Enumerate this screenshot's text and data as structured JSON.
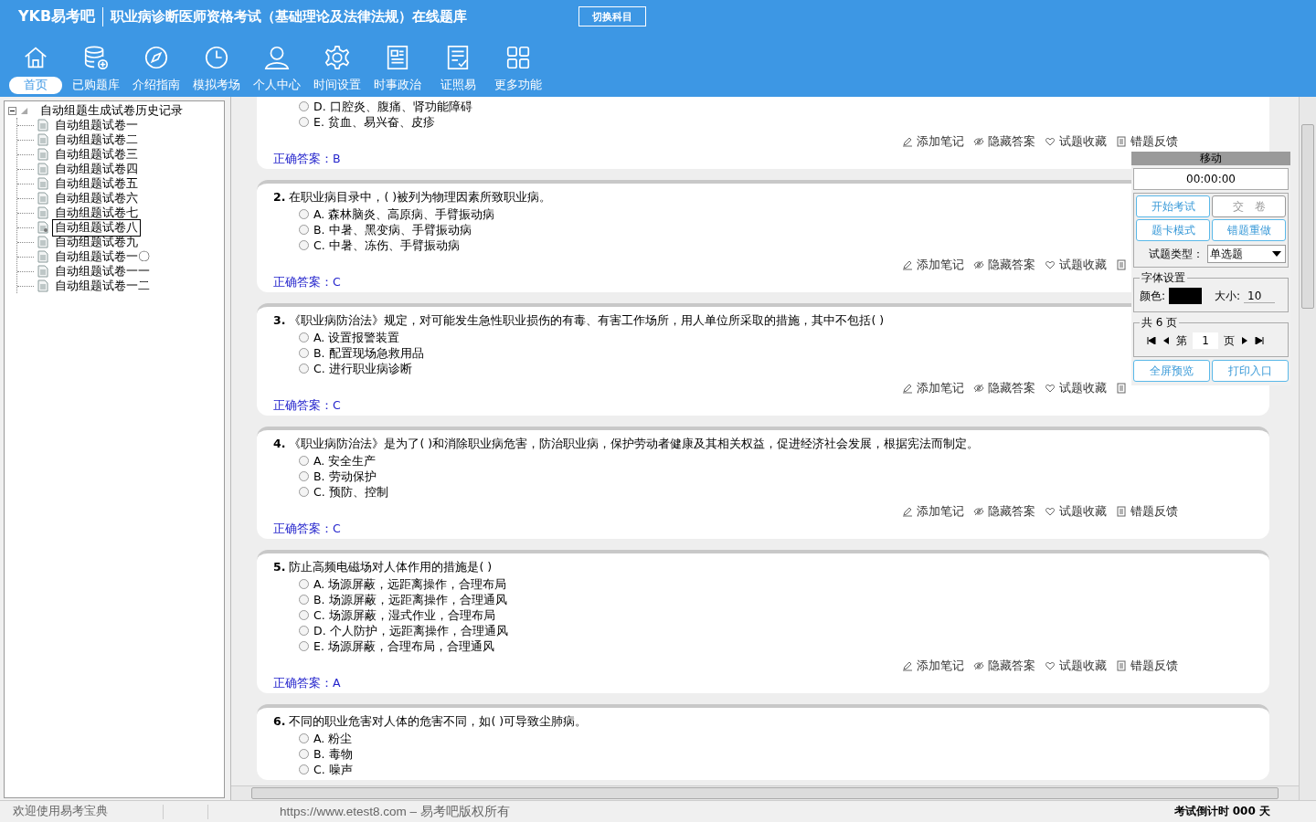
{
  "header": {
    "logo": "YKB易考吧",
    "title": "职业病诊断医师资格考试（基础理论及法律法规）在线题库",
    "switch_button": "切换科目"
  },
  "nav": [
    {
      "label": "首页",
      "kind": "home",
      "selected": true
    },
    {
      "label": "已购题库",
      "kind": "database",
      "selected": false
    },
    {
      "label": "介绍指南",
      "kind": "compass",
      "selected": false
    },
    {
      "label": "模拟考场",
      "kind": "clock",
      "selected": false
    },
    {
      "label": "个人中心",
      "kind": "person",
      "selected": false
    },
    {
      "label": "时间设置",
      "kind": "gear",
      "selected": false
    },
    {
      "label": "时事政治",
      "kind": "news",
      "selected": false
    },
    {
      "label": "证照易",
      "kind": "checklist",
      "selected": false
    },
    {
      "label": "更多功能",
      "kind": "grid",
      "selected": false
    }
  ],
  "tree": {
    "label": "自动组题生成试卷历史记录",
    "expanded": true,
    "children": [
      {
        "label": "自动组题试卷一",
        "selected": false
      },
      {
        "label": "自动组题试卷二",
        "selected": false
      },
      {
        "label": "自动组题试卷三",
        "selected": false
      },
      {
        "label": "自动组题试卷四",
        "selected": false
      },
      {
        "label": "自动组题试卷五",
        "selected": false
      },
      {
        "label": "自动组题试卷六",
        "selected": false
      },
      {
        "label": "自动组题试卷七",
        "selected": false
      },
      {
        "label": "自动组题试卷八",
        "selected": true
      },
      {
        "label": "自动组题试卷九",
        "selected": false
      },
      {
        "label": "自动组题试卷一〇",
        "selected": false
      },
      {
        "label": "自动组题试卷一一",
        "selected": false
      },
      {
        "label": "自动组题试卷一二",
        "selected": false
      }
    ]
  },
  "questions": [
    {
      "options": [
        {
          "label": "D. 口腔炎、腹痛、肾功能障碍",
          "selected": false
        },
        {
          "label": "E. 贫血、易兴奋、皮疹",
          "selected": false
        }
      ],
      "actions": [
        {
          "kind": "note",
          "label": "添加笔记"
        },
        {
          "kind": "hide",
          "label": "隐藏答案"
        },
        {
          "kind": "favorite",
          "label": "试题收藏"
        },
        {
          "kind": "feedback",
          "label": "错题反馈"
        }
      ],
      "answer": "正确答案：B"
    },
    {
      "number": "2.",
      "text": "在职业病目录中，( )被列为物理因素所致职业病。",
      "options": [
        {
          "label": "A. 森林脑炎、高原病、手臂振动病",
          "selected": false
        },
        {
          "label": "B. 中暑、黑变病、手臂振动病",
          "selected": false
        },
        {
          "label": "C. 中暑、冻伤、手臂振动病",
          "selected": false
        }
      ],
      "actions": [
        {
          "kind": "note",
          "label": "添加笔记"
        },
        {
          "kind": "hide",
          "label": "隐藏答案"
        },
        {
          "kind": "favorite",
          "label": "试题收藏"
        },
        {
          "kind": "feedback"
        }
      ],
      "answer": "正确答案：C"
    },
    {
      "number": "3.",
      "text": "《职业病防治法》规定，对可能发生急性职业损伤的有毒、有害工作场所，用人单位所采取的措施，其中不包括( )",
      "options": [
        {
          "label": "A. 设置报警装置",
          "selected": false
        },
        {
          "label": "B. 配置现场急救用品",
          "selected": false
        },
        {
          "label": "C. 进行职业病诊断",
          "selected": false
        }
      ],
      "actions": [
        {
          "kind": "note",
          "label": "添加笔记"
        },
        {
          "kind": "hide",
          "label": "隐藏答案"
        },
        {
          "kind": "favorite",
          "label": "试题收藏"
        },
        {
          "kind": "feedback"
        }
      ],
      "answer": "正确答案：C"
    },
    {
      "number": "4.",
      "text": "《职业病防治法》是为了( )和消除职业病危害，防治职业病，保护劳动者健康及其相关权益，促进经济社会发展，根据宪法而制定。",
      "options": [
        {
          "label": "A. 安全生产",
          "selected": false
        },
        {
          "label": "B. 劳动保护",
          "selected": false
        },
        {
          "label": "C. 预防、控制",
          "selected": false
        }
      ],
      "actions": [
        {
          "kind": "note",
          "label": "添加笔记"
        },
        {
          "kind": "hide",
          "label": "隐藏答案"
        },
        {
          "kind": "favorite",
          "label": "试题收藏"
        },
        {
          "kind": "feedback",
          "label": "错题反馈"
        }
      ],
      "answer": "正确答案：C"
    },
    {
      "number": "5.",
      "text": "防止高频电磁场对人体作用的措施是( )",
      "options": [
        {
          "label": "A. 场源屏蔽，远距离操作，合理布局",
          "selected": false
        },
        {
          "label": "B. 场源屏蔽，远距离操作，合理通风",
          "selected": false
        },
        {
          "label": "C. 场源屏蔽，湿式作业，合理布局",
          "selected": false
        },
        {
          "label": "D. 个人防护，远距离操作，合理通风",
          "selected": false
        },
        {
          "label": "E. 场源屏蔽，合理布局，合理通风",
          "selected": false
        }
      ],
      "actions": [
        {
          "kind": "note",
          "label": "添加笔记"
        },
        {
          "kind": "hide",
          "label": "隐藏答案"
        },
        {
          "kind": "favorite",
          "label": "试题收藏"
        },
        {
          "kind": "feedback",
          "label": "错题反馈"
        }
      ],
      "answer": "正确答案：A"
    },
    {
      "number": "6.",
      "text": "不同的职业危害对人体的危害不同，如( )可导致尘肺病。",
      "options": [
        {
          "label": "A. 粉尘",
          "selected": false
        },
        {
          "label": "B. 毒物",
          "selected": false
        },
        {
          "label": "C. 噪声",
          "selected": false
        }
      ]
    }
  ],
  "panel": {
    "title": "移动",
    "timer": "00:00:00",
    "buttons": [
      {
        "label": "开始考试",
        "disabled": false
      },
      {
        "label": "交　卷",
        "disabled": true
      },
      {
        "label": "题卡模式",
        "disabled": false
      },
      {
        "label": "错题重做",
        "disabled": false
      }
    ],
    "type_label": "试题类型：",
    "type_value": "单选题",
    "font_legend": "字体设置",
    "color_label": "颜色:",
    "color": "#000000",
    "size_label": "大小:",
    "size_value": "10",
    "pages_legend": "共 6 页",
    "page_prefix": "第",
    "page_value": "1",
    "page_suffix": "页",
    "bottom_buttons": [
      "全屏预览",
      "打印入口"
    ]
  },
  "status": {
    "welcome": "欢迎使用易考宝典",
    "copyright": "https://www.etest8.com – 易考吧版权所有",
    "countdown": "考试倒计时 000 天"
  }
}
